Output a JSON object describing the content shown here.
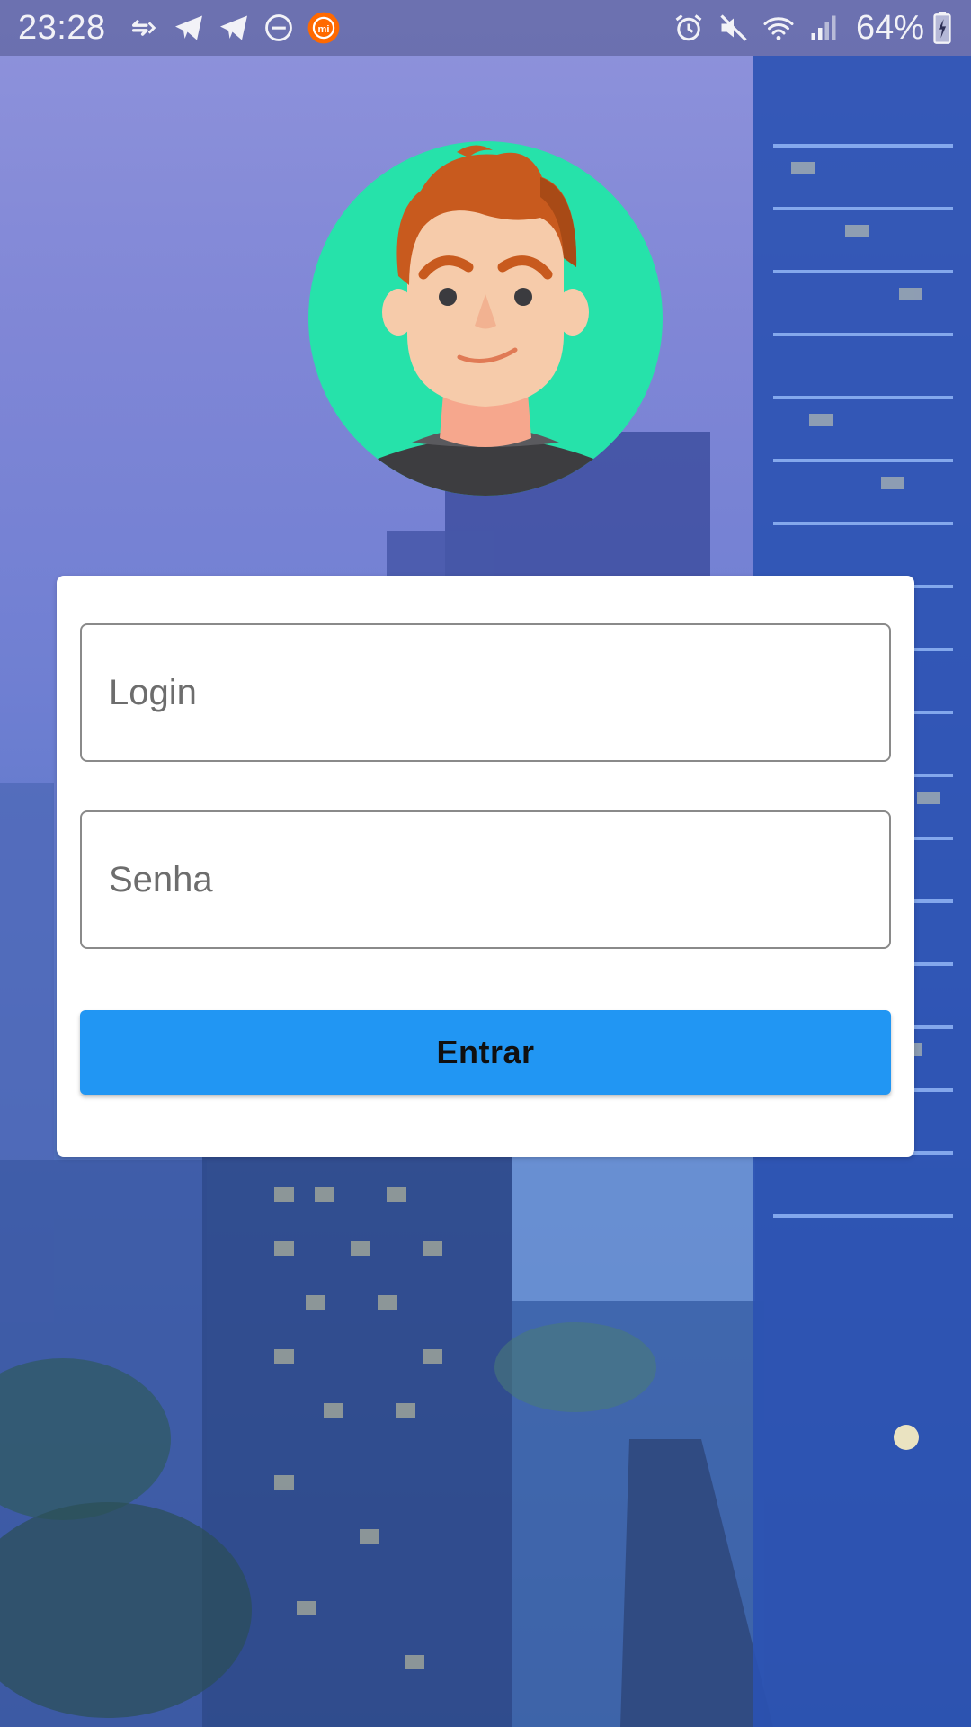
{
  "status_bar": {
    "time": "23:28",
    "battery": "64%",
    "notification_icons": [
      "transfer-icon",
      "telegram-icon",
      "telegram-icon",
      "do-not-disturb-icon",
      "mi-icon"
    ],
    "system_icons": [
      "alarm-icon",
      "mute-icon",
      "wifi-icon",
      "signal-icon",
      "battery-charging-icon"
    ]
  },
  "login_form": {
    "login_placeholder": "Login",
    "login_value": "",
    "password_placeholder": "Senha",
    "password_value": "",
    "submit_label": "Entrar"
  },
  "colors": {
    "primary_button": "#2196f3",
    "avatar_background": "#26e2aa",
    "card_background": "#ffffff"
  }
}
